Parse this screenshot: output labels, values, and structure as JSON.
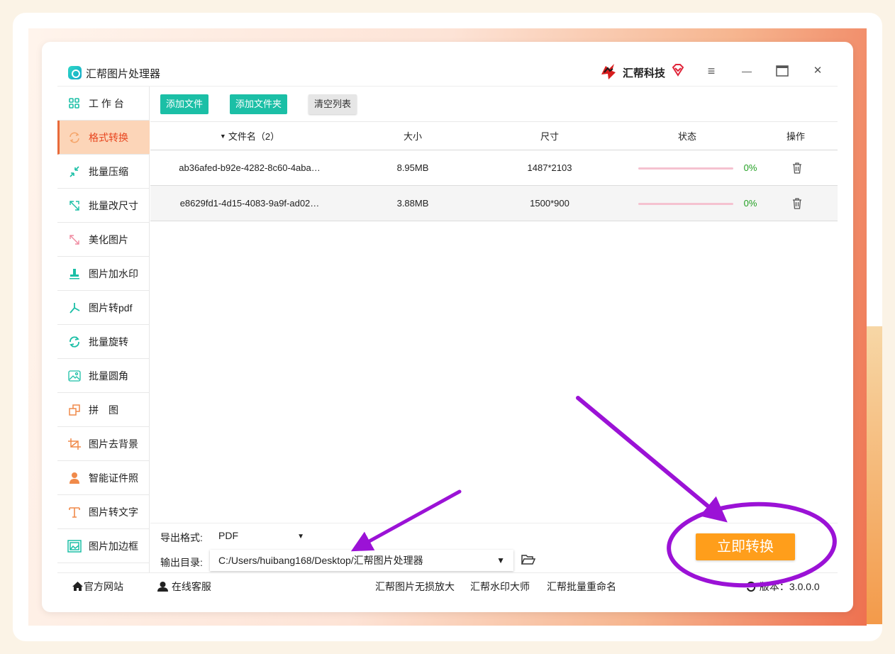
{
  "app": {
    "title": "汇帮图片处理器",
    "brand_name": "汇帮科技"
  },
  "window_controls": {
    "menu": "≡",
    "minimize": "—",
    "maximize": "□",
    "close": "✕"
  },
  "sidebar": {
    "items": [
      {
        "label": "工 作 台",
        "icon": "grid-icon",
        "color": "#1bbfa6",
        "active": false
      },
      {
        "label": "格式转换",
        "icon": "convert-icon",
        "color": "#f5a56a",
        "active": true
      },
      {
        "label": "批量压缩",
        "icon": "compress-icon",
        "color": "#1bbfa6",
        "active": false
      },
      {
        "label": "批量改尺寸",
        "icon": "resize-icon",
        "color": "#1bbfa6",
        "active": false
      },
      {
        "label": "美化图片",
        "icon": "beautify-icon",
        "color": "#f08aa0",
        "active": false
      },
      {
        "label": "图片加水印",
        "icon": "stamp-icon",
        "color": "#1bbfa6",
        "active": false
      },
      {
        "label": "图片转pdf",
        "icon": "pdf-icon",
        "color": "#1bbfa6",
        "active": false
      },
      {
        "label": "批量旋转",
        "icon": "rotate-icon",
        "color": "#1bbfa6",
        "active": false
      },
      {
        "label": "批量圆角",
        "icon": "image-icon",
        "color": "#1bbfa6",
        "active": false
      },
      {
        "label": "拼　图",
        "icon": "puzzle-icon",
        "color": "#f08a4a",
        "active": false
      },
      {
        "label": "图片去背景",
        "icon": "crop-icon",
        "color": "#f08a4a",
        "active": false
      },
      {
        "label": "智能证件照",
        "icon": "person-icon",
        "color": "#f08a4a",
        "active": false
      },
      {
        "label": "图片转文字",
        "icon": "text-icon",
        "color": "#f08a4a",
        "active": false
      },
      {
        "label": "图片加边框",
        "icon": "frame-icon",
        "color": "#1bbfa6",
        "active": false
      }
    ]
  },
  "toolbar": {
    "add_file": "添加文件",
    "add_folder": "添加文件夹",
    "clear_list": "清空列表"
  },
  "table": {
    "headers": {
      "name": "文件名（2）",
      "size": "大小",
      "dimensions": "尺寸",
      "status": "状态",
      "action": "操作"
    },
    "rows": [
      {
        "name": "ab36afed-b92e-4282-8c60-4aba…",
        "size": "8.95MB",
        "dimensions": "1487*2103",
        "progress": 0,
        "progress_label": "0%"
      },
      {
        "name": "e8629fd1-4d15-4083-9a9f-ad02…",
        "size": "3.88MB",
        "dimensions": "1500*900",
        "progress": 0,
        "progress_label": "0%"
      }
    ]
  },
  "export": {
    "format_label": "导出格式:",
    "format_value": "PDF",
    "dir_label": "输出目录:",
    "dir_value": "C:/Users/huibang168/Desktop/汇帮图片处理器",
    "convert_button": "立即转换"
  },
  "statusbar": {
    "website": "官方网站",
    "support": "在线客服",
    "link1": "汇帮图片无损放大",
    "link2": "汇帮水印大师",
    "link3": "汇帮批量重命名",
    "version": "版本：3.0.0.0"
  },
  "colors": {
    "accent_teal": "#1bbfa6",
    "accent_orange": "#ff9e1b",
    "annotation_purple": "#9b12d6"
  }
}
